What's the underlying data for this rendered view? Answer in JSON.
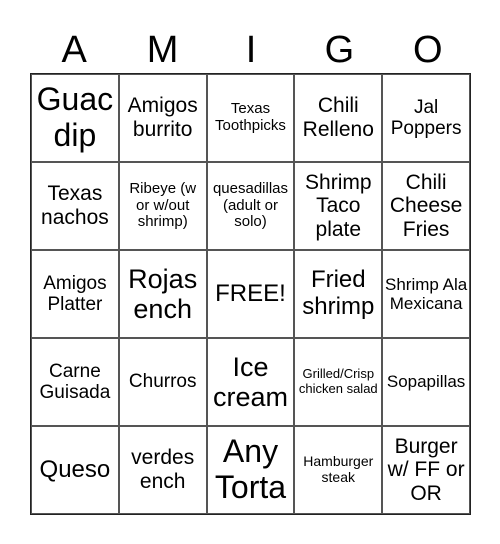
{
  "header": [
    "A",
    "M",
    "I",
    "G",
    "O"
  ],
  "cells": [
    [
      "Guac dip",
      "Amigos burrito",
      "Texas Toothpicks",
      "Chili Relleno",
      "Jal Poppers"
    ],
    [
      "Texas nachos",
      "Ribeye (w or w/out shrimp)",
      "quesadillas (adult or solo)",
      "Shrimp Taco plate",
      "Chili Cheese Fries"
    ],
    [
      "Amigos Platter",
      "Rojas ench",
      "FREE!",
      "Fried shrimp",
      "Shrimp Ala Mexicana"
    ],
    [
      "Carne Guisada",
      "Churros",
      "Ice cream",
      "Grilled/Crisp chicken salad",
      "Sopapillas"
    ],
    [
      "Queso",
      "verdes ench",
      "Any Torta",
      "Hamburger steak",
      "Burger w/ FF or OR"
    ]
  ]
}
